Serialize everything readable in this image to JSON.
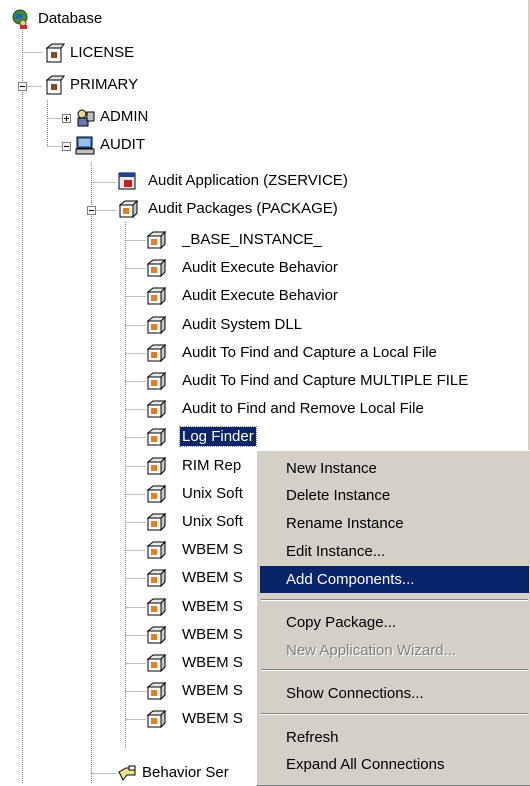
{
  "tree": {
    "root": "Database",
    "license": "LICENSE",
    "primary": "PRIMARY",
    "admin": "ADMIN",
    "audit": "AUDIT",
    "audit_application": "Audit Application (ZSERVICE)",
    "audit_packages": "Audit Packages (PACKAGE)",
    "packages": [
      "_BASE_INSTANCE_",
      "Audit Execute Behavior",
      "Audit Execute Behavior",
      "Audit System DLL",
      "Audit To Find and Capture a Local File",
      "Audit To Find and Capture MULTIPLE FILE",
      "Audit to Find and Remove Local File",
      "Log Finder",
      "RIM Rep",
      "Unix Soft",
      "Unix Soft",
      "WBEM S",
      "WBEM S",
      "WBEM S",
      "WBEM S",
      "WBEM S",
      "WBEM S",
      "WBEM S"
    ],
    "behavior": "Behavior Ser"
  },
  "context_menu": {
    "items": [
      "New Instance",
      "Delete Instance",
      "Rename Instance",
      "Edit Instance...",
      "Add Components...",
      "Copy Package...",
      "New Application Wizard...",
      "Show Connections...",
      "Refresh",
      "Expand All Connections"
    ],
    "highlighted": "Add Components...",
    "disabled": "New Application Wizard..."
  },
  "colors": {
    "selection": "#0a246a",
    "menu_bg": "#d4d0c8",
    "tree_lines": "#808080"
  },
  "icons": {
    "root": "globe-user-icon",
    "license": "license-package-icon",
    "primary": "primary-file-icon",
    "admin": "admin-icon",
    "audit": "audit-computer-icon",
    "application": "application-icon",
    "package": "package-icon",
    "behavior": "behavior-icon"
  }
}
